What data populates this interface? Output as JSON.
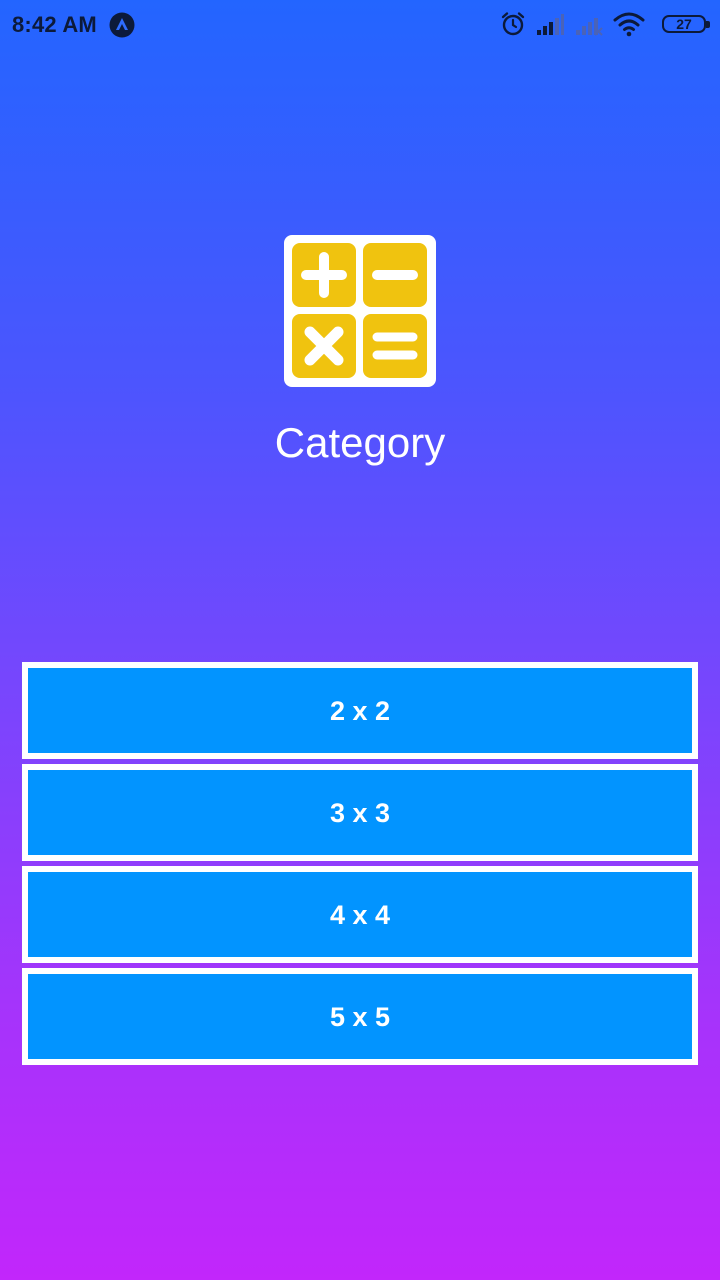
{
  "status_bar": {
    "time": "8:42 AM",
    "battery": "27",
    "icons": [
      "app-notification-icon",
      "alarm-icon",
      "signal-icon",
      "signal-no-service-icon",
      "wifi-icon",
      "battery-icon"
    ]
  },
  "header": {
    "logo_icon": "calculator-icon",
    "title": "Category"
  },
  "categories": [
    {
      "label": "2 x 2"
    },
    {
      "label": "3 x 3"
    },
    {
      "label": "4 x 4"
    },
    {
      "label": "5 x 5"
    }
  ],
  "colors": {
    "background_top": "#2365ff",
    "background_bottom": "#c226fb",
    "button_fill": "#0294ff",
    "button_border": "#ffffff",
    "logo_tile": "#f0c30f"
  }
}
